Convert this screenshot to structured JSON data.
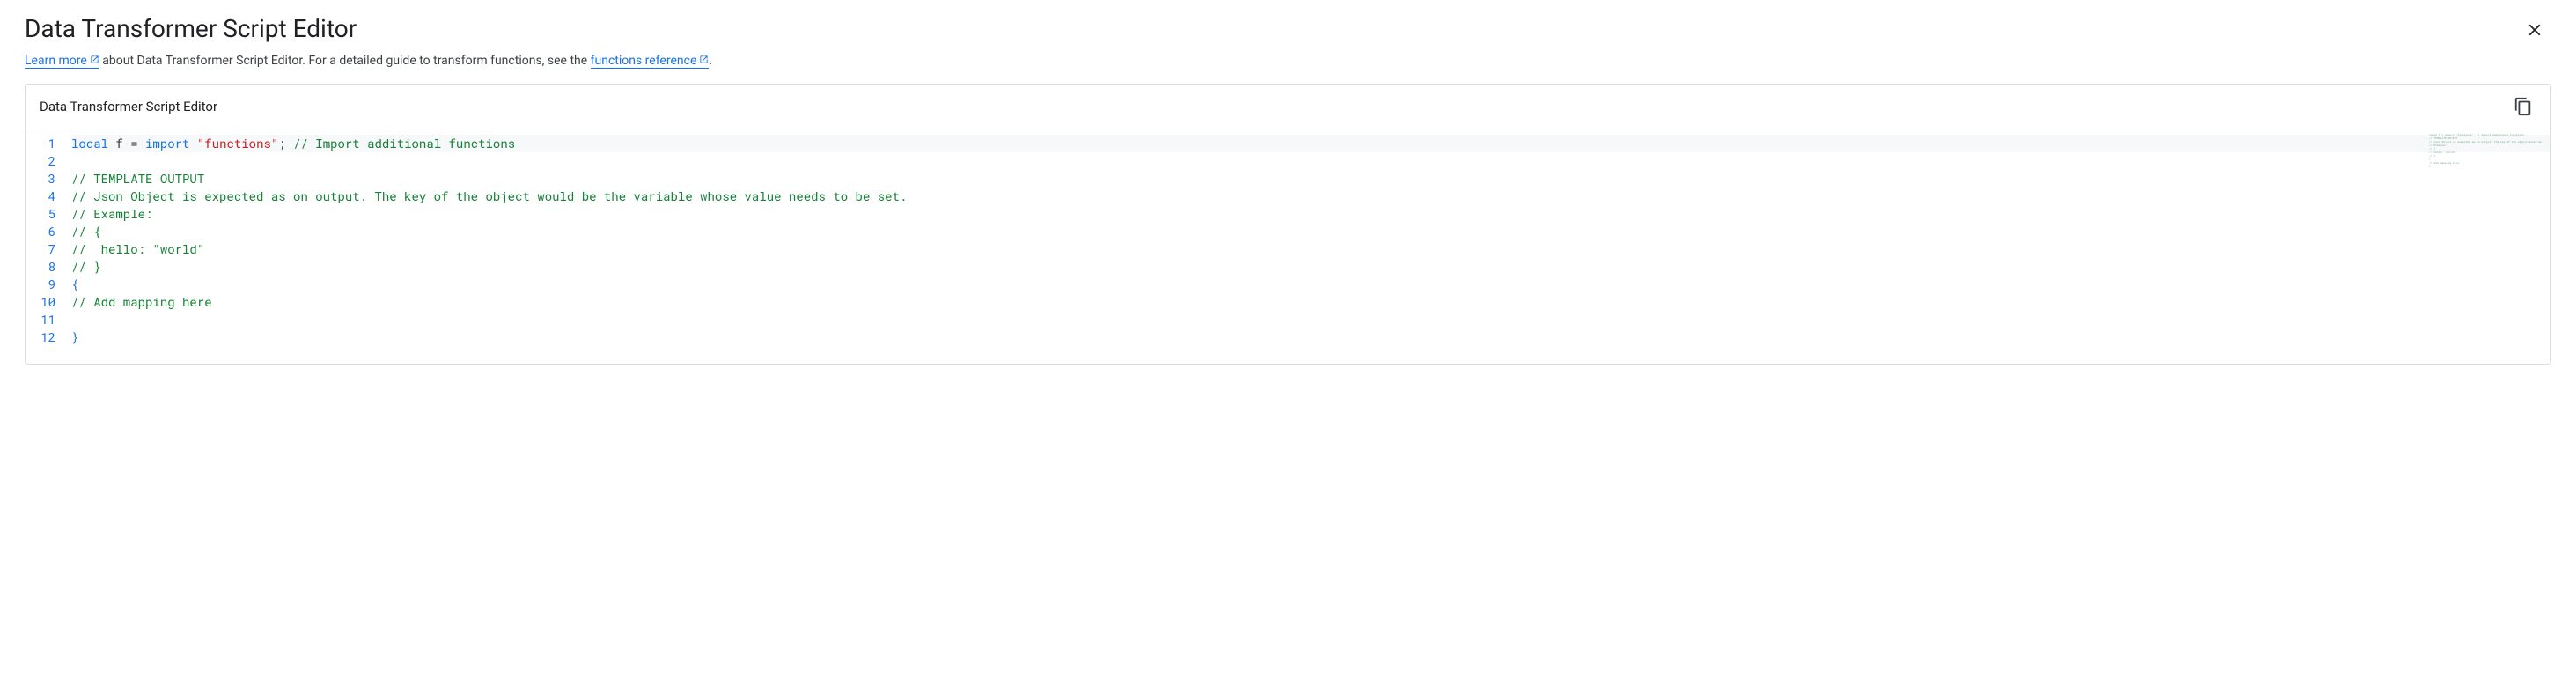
{
  "header": {
    "title": "Data Transformer Script Editor",
    "learn_more_label": "Learn more",
    "subtitle_mid": " about Data Transformer Script Editor. For a detailed guide to transform functions, see the ",
    "functions_ref_label": "functions reference",
    "subtitle_end": "."
  },
  "editor": {
    "panel_title": "Data Transformer Script Editor",
    "line_count": 12,
    "lines": [
      {
        "n": 1,
        "type": "mixed",
        "highlighted": true,
        "tokens": [
          {
            "t": "local",
            "c": "tok-keyword"
          },
          {
            "t": " f = ",
            "c": "tok-punct"
          },
          {
            "t": "import",
            "c": "tok-keyword"
          },
          {
            "t": " ",
            "c": "tok-punct"
          },
          {
            "t": "\"functions\"",
            "c": "tok-string"
          },
          {
            "t": "; ",
            "c": "tok-punct"
          },
          {
            "t": "// Import additional functions",
            "c": "tok-comment"
          }
        ]
      },
      {
        "n": 2,
        "type": "blank",
        "tokens": []
      },
      {
        "n": 3,
        "type": "comment",
        "tokens": [
          {
            "t": "// TEMPLATE OUTPUT",
            "c": "tok-comment"
          }
        ]
      },
      {
        "n": 4,
        "type": "comment",
        "tokens": [
          {
            "t": "// Json Object is expected as on output. The key of the object would be the variable whose value needs to be set.",
            "c": "tok-comment"
          }
        ]
      },
      {
        "n": 5,
        "type": "comment",
        "tokens": [
          {
            "t": "// Example:",
            "c": "tok-comment"
          }
        ]
      },
      {
        "n": 6,
        "type": "comment",
        "tokens": [
          {
            "t": "// {",
            "c": "tok-comment"
          }
        ]
      },
      {
        "n": 7,
        "type": "comment",
        "tokens": [
          {
            "t": "//  hello: \"world\"",
            "c": "tok-comment"
          }
        ]
      },
      {
        "n": 8,
        "type": "comment",
        "tokens": [
          {
            "t": "// }",
            "c": "tok-comment"
          }
        ]
      },
      {
        "n": 9,
        "type": "plain",
        "tokens": [
          {
            "t": "{",
            "c": "tok-plain"
          }
        ]
      },
      {
        "n": 10,
        "type": "comment",
        "tokens": [
          {
            "t": "// Add mapping here",
            "c": "tok-comment"
          }
        ]
      },
      {
        "n": 11,
        "type": "blank",
        "tokens": []
      },
      {
        "n": 12,
        "type": "plain",
        "tokens": [
          {
            "t": "}",
            "c": "tok-plain"
          }
        ]
      }
    ]
  }
}
